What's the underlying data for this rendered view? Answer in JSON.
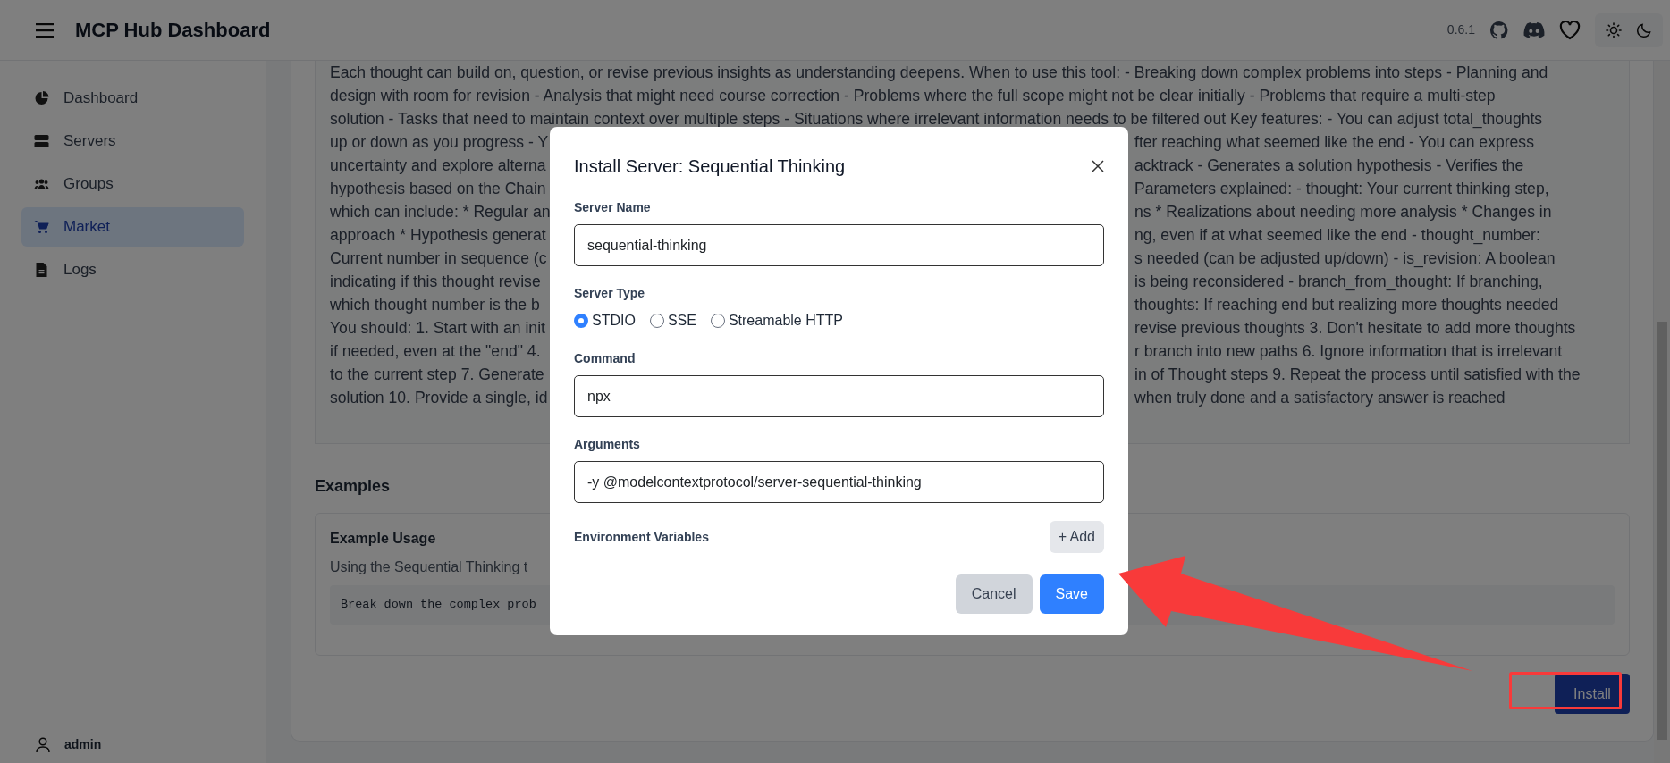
{
  "header": {
    "title": "MCP Hub Dashboard",
    "version": "0.6.1"
  },
  "sidebar": {
    "items": [
      {
        "label": "Dashboard",
        "kind": "dashboard",
        "selected": false
      },
      {
        "label": "Servers",
        "kind": "servers",
        "selected": false
      },
      {
        "label": "Groups",
        "kind": "groups",
        "selected": false
      },
      {
        "label": "Market",
        "kind": "market",
        "selected": true
      },
      {
        "label": "Logs",
        "kind": "logs",
        "selected": false
      }
    ],
    "user": "admin"
  },
  "description_lines": [
    {
      "text": "Each thought can build on, question, or revise previous insights as understanding deepens. When to use this tool: - Breaking down complex problems into steps - Planning and"
    },
    {
      "text": "design with room for revision - Analysis that might need course correction - Problems where the full scope might not be clear initially - Problems that require a multi-step"
    },
    {
      "text": "solution - Tasks that need to maintain context over multiple steps - Situations where irrelevant information needs to be filtered out Key features: - You can adjust total_thoughts"
    },
    {
      "left": "up or down as you progress - Y",
      "right": "fter reaching what seemed like the end - You can express"
    },
    {
      "left": "uncertainty and explore alterna",
      "right": "acktrack - Generates a solution hypothesis - Verifies the"
    },
    {
      "left": "hypothesis based on the Chain",
      "right": "Parameters explained: - thought: Your current thinking step,"
    },
    {
      "left": "which can include: * Regular an",
      "right": "ns * Realizations about needing more analysis * Changes in"
    },
    {
      "left": "approach * Hypothesis generat",
      "right": "ng, even if at what seemed like the end - thought_number:"
    },
    {
      "left": "Current number in sequence (c",
      "right": "s needed (can be adjusted up/down) - is_revision: A boolean"
    },
    {
      "left": "indicating if this thought revise",
      "right": "is being reconsidered - branch_from_thought: If branching,"
    },
    {
      "left": "which thought number is the b",
      "right": "thoughts: If reaching end but realizing more thoughts needed"
    },
    {
      "left": "You should: 1. Start with an init",
      "right": "revise previous thoughts 3. Don't hesitate to add more thoughts"
    },
    {
      "left": "if needed, even at the \"end\" 4.",
      "right": "r branch into new paths 6. Ignore information that is irrelevant"
    },
    {
      "left": "to the current step 7. Generate",
      "right": "in of Thought steps 9. Repeat the process until satisfied with the"
    },
    {
      "left": "solution 10. Provide a single, id",
      "right": "when truly done and a satisfactory answer is reached"
    }
  ],
  "examples": {
    "heading": "Examples",
    "card_title": "Example Usage",
    "text": "Using the Sequential Thinking t",
    "code": "Break down the complex prob"
  },
  "install_button": "Install",
  "modal": {
    "title": "Install Server: Sequential Thinking",
    "fields": [
      {
        "kind": "text",
        "label": "Server Name",
        "value": "sequential-thinking"
      },
      {
        "kind": "radio",
        "label": "Server Type",
        "options": [
          {
            "label": "STDIO",
            "selected": true
          },
          {
            "label": "SSE",
            "selected": false
          },
          {
            "label": "Streamable HTTP",
            "selected": false
          }
        ]
      },
      {
        "kind": "text",
        "label": "Command",
        "value": "npx"
      },
      {
        "kind": "text",
        "label": "Arguments",
        "value": "-y @modelcontextprotocol/server-sequential-thinking"
      },
      {
        "kind": "env",
        "label": "Environment Variables",
        "button": "+ Add"
      }
    ],
    "buttons": [
      {
        "label": "Cancel",
        "kind": "secondary"
      },
      {
        "label": "Save",
        "kind": "primary"
      }
    ]
  }
}
